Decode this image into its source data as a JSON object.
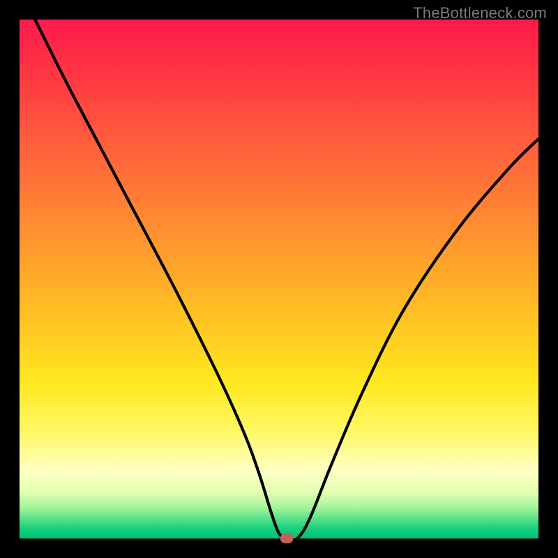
{
  "watermark": "TheBottleneck.com",
  "chart_data": {
    "type": "line",
    "title": "",
    "xlabel": "",
    "ylabel": "",
    "xlim": [
      0,
      100
    ],
    "ylim": [
      0,
      100
    ],
    "grid": false,
    "series": [
      {
        "name": "curve",
        "x": [
          3,
          10,
          20,
          30,
          38,
          43,
          46,
          48.5,
          50,
          51.5,
          53.5,
          56,
          60,
          66,
          74,
          84,
          94,
          100
        ],
        "values": [
          100,
          86,
          67,
          48,
          32,
          21,
          13,
          5,
          1,
          0,
          0,
          4,
          14,
          28,
          44,
          59,
          71,
          77
        ]
      }
    ],
    "marker": {
      "x": 51.5,
      "y": 0,
      "color": "#c1625a"
    },
    "gradient_stops": [
      {
        "pos": 0,
        "color": "#ff1a4d"
      },
      {
        "pos": 12,
        "color": "#ff3b42"
      },
      {
        "pos": 28,
        "color": "#ff6a3a"
      },
      {
        "pos": 44,
        "color": "#ff9a2e"
      },
      {
        "pos": 58,
        "color": "#ffc423"
      },
      {
        "pos": 70,
        "color": "#ffe81f"
      },
      {
        "pos": 80,
        "color": "#fff96a"
      },
      {
        "pos": 87,
        "color": "#ffffc4"
      },
      {
        "pos": 91,
        "color": "#e3ffb0"
      },
      {
        "pos": 94,
        "color": "#a4f59a"
      },
      {
        "pos": 96,
        "color": "#5fe48b"
      },
      {
        "pos": 98,
        "color": "#1bd07e"
      },
      {
        "pos": 100,
        "color": "#00c474"
      }
    ]
  }
}
